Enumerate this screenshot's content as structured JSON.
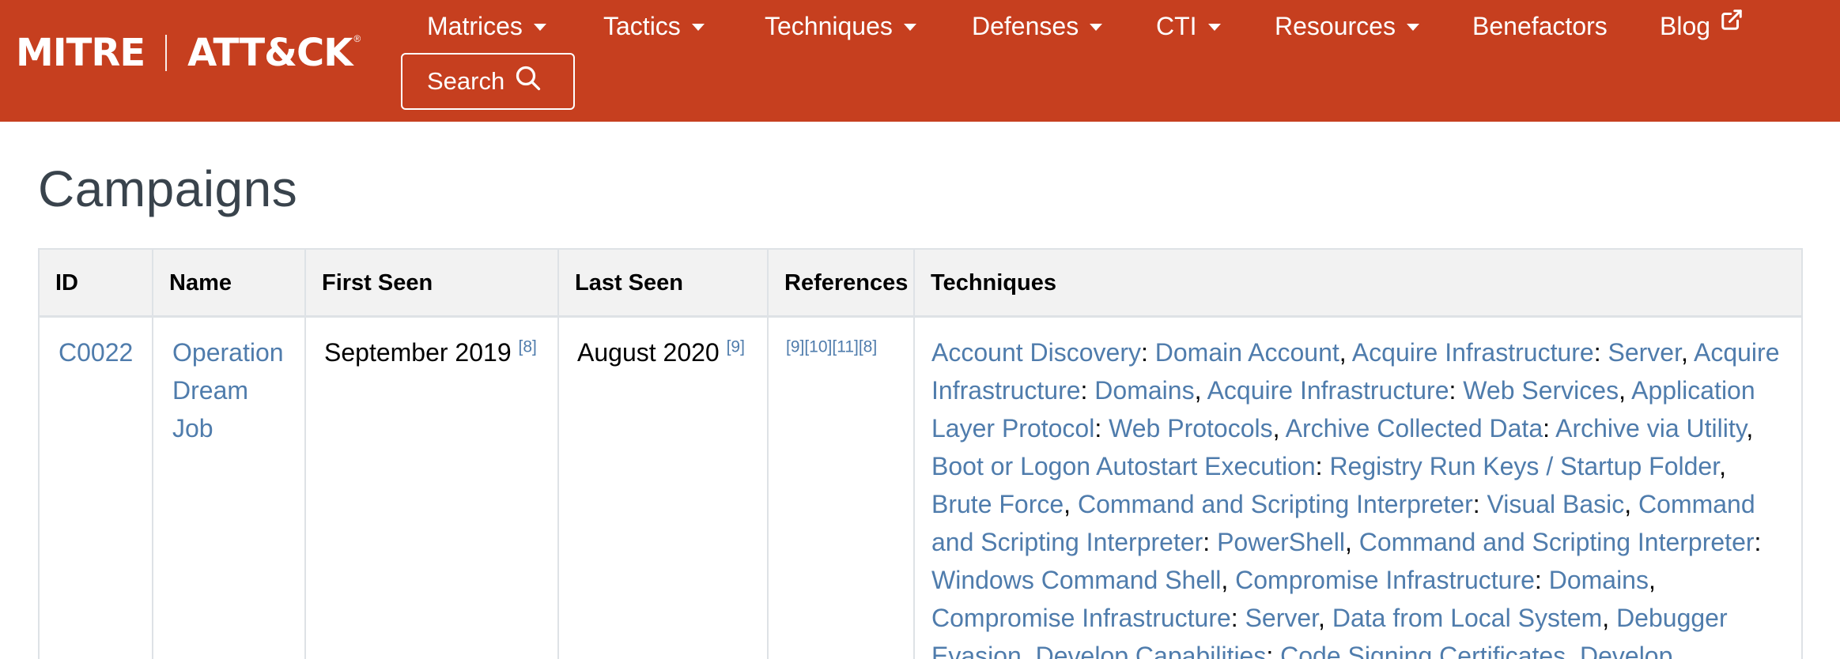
{
  "header": {
    "logo_left": "MITRE",
    "logo_right": "ATT&CK",
    "logo_mark": "®",
    "nav": [
      {
        "label": "Matrices",
        "has_caret": true
      },
      {
        "label": "Tactics",
        "has_caret": true
      },
      {
        "label": "Techniques",
        "has_caret": true
      },
      {
        "label": "Defenses",
        "has_caret": true
      },
      {
        "label": "CTI",
        "has_caret": true
      },
      {
        "label": "Resources",
        "has_caret": true
      },
      {
        "label": "Benefactors",
        "has_caret": false
      },
      {
        "label": "Blog",
        "has_caret": false,
        "icon": "external-link-icon"
      }
    ],
    "search_label": "Search",
    "search_icon": "search-icon",
    "background_color": "#c63f1f"
  },
  "page": {
    "title": "Campaigns"
  },
  "table": {
    "columns": [
      "ID",
      "Name",
      "First Seen",
      "Last Seen",
      "References",
      "Techniques"
    ],
    "rows": [
      {
        "id": "C0022",
        "name_lines": [
          "Operation",
          "Dream",
          "Job"
        ],
        "first_seen": "September 2019",
        "first_seen_ref": "[8]",
        "last_seen": "August 2020",
        "last_seen_ref": "[9]",
        "references": "[9][10][11][8]",
        "technique_lines": [
          [
            [
              "link",
              "Account Discovery"
            ],
            [
              "text",
              ": "
            ],
            [
              "link",
              "Domain Account"
            ],
            [
              "text",
              ", "
            ],
            [
              "link",
              "Acquire Infrastructure"
            ],
            [
              "text",
              ": "
            ],
            [
              "link",
              "Server"
            ],
            [
              "text",
              ", "
            ],
            [
              "link",
              "Acquire"
            ]
          ],
          [
            [
              "link",
              "Infrastructure"
            ],
            [
              "text",
              ": "
            ],
            [
              "link",
              "Domains"
            ],
            [
              "text",
              ", "
            ],
            [
              "link",
              "Acquire Infrastructure"
            ],
            [
              "text",
              ": "
            ],
            [
              "link",
              "Web Services"
            ],
            [
              "text",
              ", "
            ],
            [
              "link",
              "Application"
            ]
          ],
          [
            [
              "link",
              "Layer Protocol"
            ],
            [
              "text",
              ": "
            ],
            [
              "link",
              "Web Protocols"
            ],
            [
              "text",
              ", "
            ],
            [
              "link",
              "Archive Collected Data"
            ],
            [
              "text",
              ": "
            ],
            [
              "link",
              "Archive via Utility"
            ],
            [
              "text",
              ","
            ]
          ],
          [
            [
              "link",
              "Boot or Logon Autostart Execution"
            ],
            [
              "text",
              ": "
            ],
            [
              "link",
              "Registry Run Keys / Startup Folder"
            ],
            [
              "text",
              ","
            ]
          ],
          [
            [
              "link",
              "Brute Force"
            ],
            [
              "text",
              ", "
            ],
            [
              "link",
              "Command and Scripting Interpreter"
            ],
            [
              "text",
              ": "
            ],
            [
              "link",
              "Visual Basic"
            ],
            [
              "text",
              ", "
            ],
            [
              "link",
              "Command"
            ]
          ],
          [
            [
              "link",
              "and Scripting Interpreter"
            ],
            [
              "text",
              ": "
            ],
            [
              "link",
              "PowerShell"
            ],
            [
              "text",
              ", "
            ],
            [
              "link",
              "Command and Scripting Interpreter"
            ],
            [
              "text",
              ":"
            ]
          ],
          [
            [
              "link",
              "Windows Command Shell"
            ],
            [
              "text",
              ", "
            ],
            [
              "link",
              "Compromise Infrastructure"
            ],
            [
              "text",
              ": "
            ],
            [
              "link",
              "Domains"
            ],
            [
              "text",
              ","
            ]
          ],
          [
            [
              "link",
              "Compromise Infrastructure"
            ],
            [
              "text",
              ": "
            ],
            [
              "link",
              "Server"
            ],
            [
              "text",
              ", "
            ],
            [
              "link",
              "Data from Local System"
            ],
            [
              "text",
              ", "
            ],
            [
              "link",
              "Debugger"
            ]
          ],
          [
            [
              "link",
              "Evasion"
            ],
            [
              "text",
              ", "
            ],
            [
              "link",
              "Develop Capabilities"
            ],
            [
              "text",
              ": "
            ],
            [
              "link",
              "Code Signing Certificates"
            ],
            [
              "text",
              ", "
            ],
            [
              "link",
              "Develop"
            ]
          ]
        ]
      }
    ]
  },
  "colors": {
    "brand": "#c63f1f",
    "link": "#4f7cac",
    "heading": "#39434c",
    "table_header_bg": "#f2f2f2",
    "border": "#dee2e6"
  }
}
